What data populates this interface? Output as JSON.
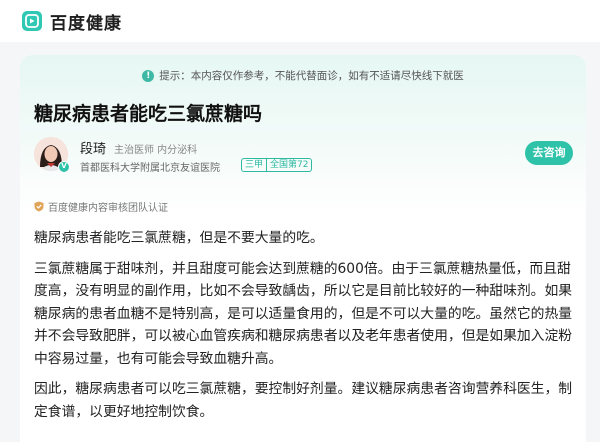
{
  "header": {
    "brand": "百度健康"
  },
  "notice": {
    "text": "提示：本内容仅作参考，不能代替面诊，如有不适请尽快线下就医"
  },
  "article": {
    "title": "糖尿病患者能吃三氯蔗糖吗",
    "author": {
      "name": "段琦",
      "title": "主治医师 内分泌科",
      "hospital": "首都医科大学附属北京友谊医院",
      "tags": [
        "三甲",
        "全国第72"
      ]
    },
    "consult_label": "去咨询",
    "review_note": "百度健康内容审核团队认证",
    "paragraphs": [
      "糖尿病患者能吃三氯蔗糖，但是不要大量的吃。",
      "三氯蔗糖属于甜味剂，并且甜度可能会达到蔗糖的600倍。由于三氯蔗糖热量低，而且甜度高，没有明显的副作用，比如不会导致龋齿，所以它是目前比较好的一种甜味剂。如果糖尿病的患者血糖不是特别高，是可以适量食用的，但是不可以大量的吃。虽然它的热量并不会导致肥胖，可以被心血管疾病和糖尿病患者以及老年患者使用，但是如果加入淀粉中容易过量，也有可能会导致血糖升高。",
      "因此，糖尿病患者可以吃三氯蔗糖，要控制好剂量。建议糖尿病患者咨询营养科医生，制定食谱，以更好地控制饮食。"
    ]
  },
  "colors": {
    "accent": "#2ec3a9",
    "head_bg": "#e6f7f3"
  }
}
